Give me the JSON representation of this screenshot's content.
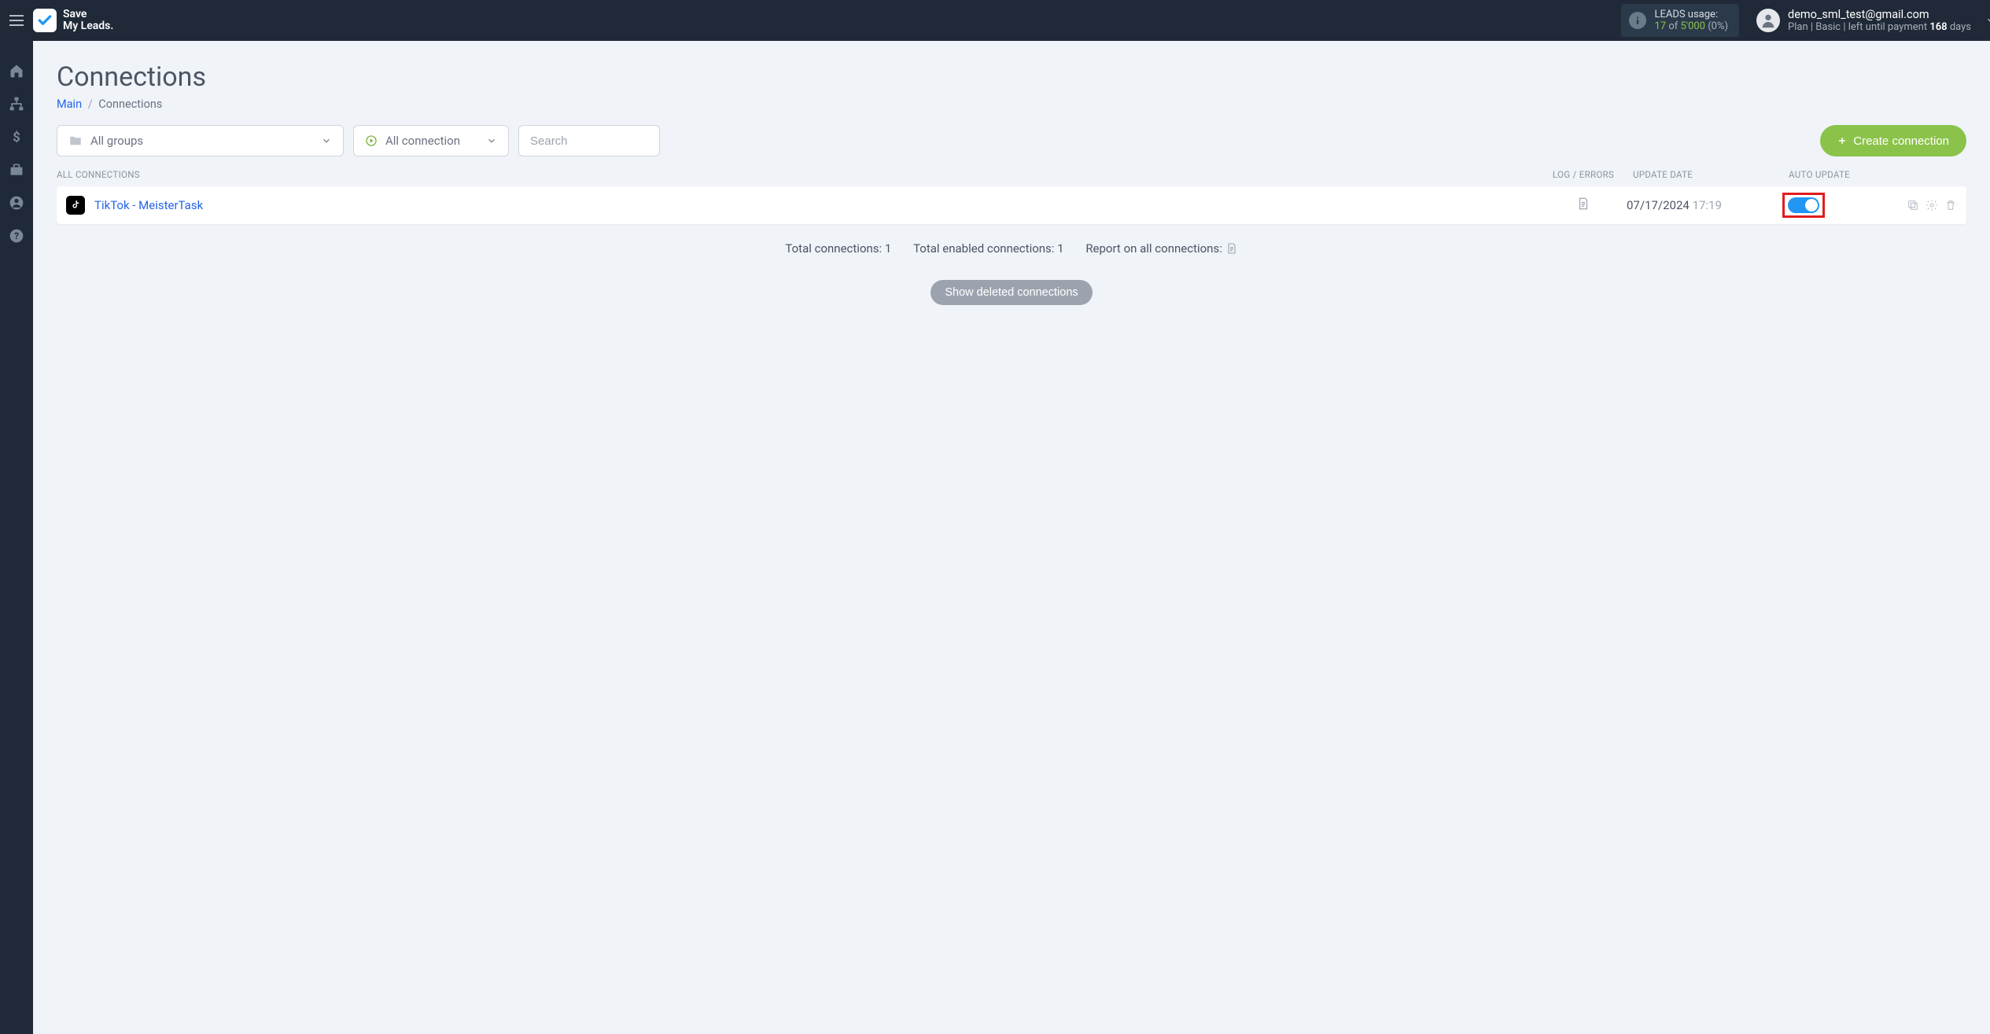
{
  "brand": {
    "line1": "Save",
    "line2": "My Leads."
  },
  "leads_usage": {
    "label": "LEADS usage:",
    "used": "17",
    "of": "of",
    "total": "5'000",
    "pct": "(0%)"
  },
  "user": {
    "email": "demo_sml_test@gmail.com",
    "plan_prefix": "Plan | Basic |  left until payment ",
    "plan_days": "168",
    "plan_suffix": " days"
  },
  "page": {
    "title": "Connections",
    "breadcrumb_main": "Main",
    "breadcrumb_sep": "/",
    "breadcrumb_current": "Connections"
  },
  "toolbar": {
    "groups_label": "All groups",
    "status_label": "All connection",
    "search_placeholder": "Search",
    "create_label": "Create connection"
  },
  "columns": {
    "name": "ALL CONNECTIONS",
    "log": "LOG / ERRORS",
    "date": "UPDATE DATE",
    "auto": "AUTO UPDATE"
  },
  "row": {
    "name": "TikTok - MeisterTask",
    "date": "07/17/2024",
    "time": "17:19"
  },
  "summary": {
    "total": "Total connections: 1",
    "enabled": "Total enabled connections: 1",
    "report": "Report on all connections:"
  },
  "show_deleted": "Show deleted connections"
}
